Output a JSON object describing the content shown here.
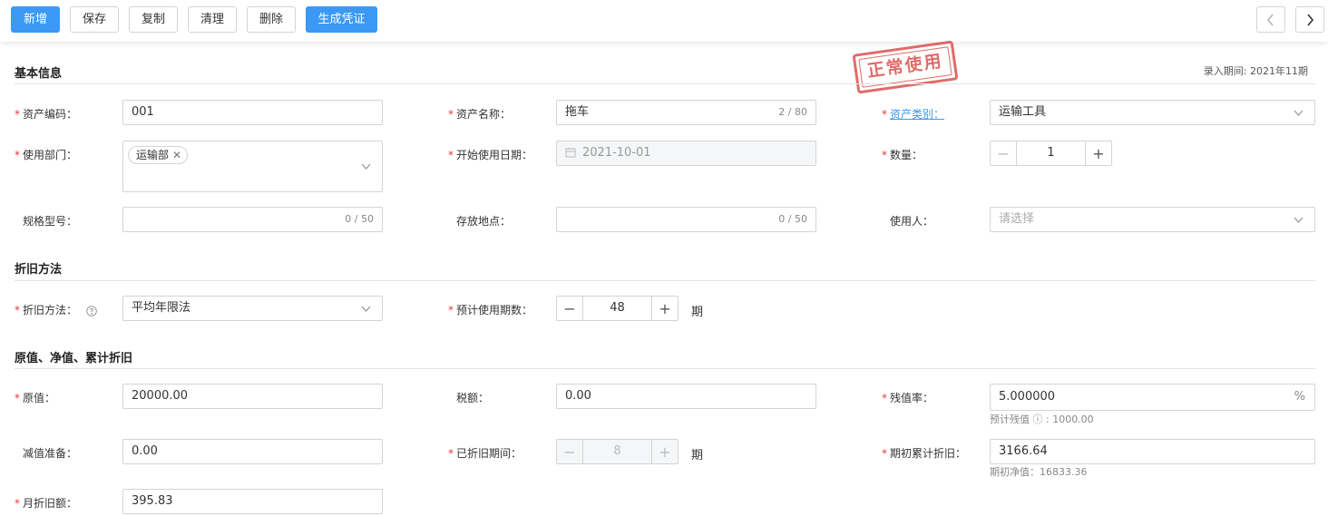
{
  "toolbar": {
    "buttons": [
      "新增",
      "保存",
      "复制",
      "清理",
      "删除",
      "生成凭证"
    ]
  },
  "stamp": {
    "text": "正常使用"
  },
  "header": {
    "period": "录入期间: 2021年11期"
  },
  "sections": {
    "basic": "基本信息",
    "depreciation": "折旧方法",
    "values": "原值、净值、累计折旧"
  },
  "basic": {
    "asset_code": {
      "label": "资产编码：",
      "value": "001"
    },
    "asset_name": {
      "label": "资产名称：",
      "value": "拖车",
      "counter": "2 / 80"
    },
    "asset_category": {
      "label": "资产类别：",
      "value": "运输工具"
    },
    "department": {
      "label": "使用部门：",
      "tag": "运输部",
      "tag_close": "✕"
    },
    "start_date": {
      "label": "开始使用日期：",
      "value": "2021-10-01"
    },
    "quantity": {
      "label": "数量：",
      "value": "1"
    },
    "spec_model": {
      "label": "规格型号：",
      "counter": "0 / 50"
    },
    "location": {
      "label": "存放地点：",
      "counter": "0 / 50"
    },
    "user": {
      "label": "使用人：",
      "placeholder": "请选择"
    }
  },
  "depreciation": {
    "method": {
      "label": "折旧方法：",
      "value": "平均年限法"
    },
    "expected_periods": {
      "label": "预计使用期数：",
      "value": "48",
      "suffix": "期"
    }
  },
  "values": {
    "original": {
      "label": "原值：",
      "value": "20000.00"
    },
    "tax": {
      "label": "税额：",
      "value": "0.00"
    },
    "residual_rate": {
      "label": "残值率：",
      "value": "5.000000",
      "unit": "%",
      "hint": "预计残值 ⓘ : 1000.00"
    },
    "impairment": {
      "label": "减值准备：",
      "value": "0.00"
    },
    "depreciated_periods": {
      "label": "已折旧期间：",
      "value": "8",
      "suffix": "期"
    },
    "opening_accum": {
      "label": "期初累计折旧：",
      "value": "3166.64",
      "hint": "期初净值：16833.36"
    },
    "monthly": {
      "label": "月折旧额：",
      "value": "395.83"
    }
  },
  "colors": {
    "primary": "#3b99f5",
    "required": "#e4393c",
    "stamp": "#d9534f"
  },
  "icons": [
    "chevron-left-icon",
    "chevron-right-icon",
    "chevron-down-icon",
    "calendar-icon",
    "help-icon",
    "close-icon"
  ]
}
